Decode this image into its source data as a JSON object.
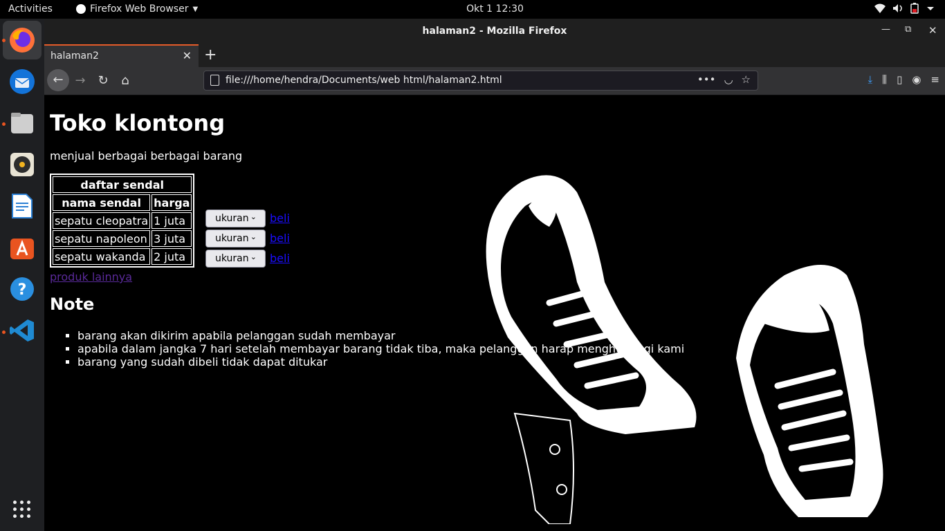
{
  "topbar": {
    "activities": "Activities",
    "app_menu": "Firefox Web Browser",
    "clock": "Okt 1  12:30"
  },
  "dock": {
    "items": [
      "firefox-icon",
      "thunderbird-icon",
      "files-icon",
      "rhythmbox-icon",
      "libreoffice-writer-icon",
      "software-center-icon",
      "help-icon",
      "vscode-icon"
    ],
    "apps_grid": "show-applications-icon"
  },
  "window": {
    "title": "halaman2 - Mozilla Firefox",
    "tab_title": "halaman2",
    "url": "file:///home/hendra/Documents/web html/halaman2.html"
  },
  "page": {
    "heading": "Toko klontong",
    "subtitle": "menjual berbagai berbagai barang",
    "table": {
      "caption": "daftar sendal",
      "headers": [
        "nama sendal",
        "harga"
      ],
      "rows": [
        {
          "name": "sepatu cleopatra",
          "price": "1 juta",
          "select": "ukuran",
          "buy": "beli"
        },
        {
          "name": "sepatu napoleon",
          "price": "3 juta",
          "select": "ukuran",
          "buy": "beli"
        },
        {
          "name": "sepatu wakanda",
          "price": "2 juta",
          "select": "ukuran",
          "buy": "beli"
        }
      ]
    },
    "other_link": "produk lainnya",
    "note_heading": "Note",
    "notes": [
      "barang akan dikirim apabila pelanggan sudah membayar",
      "apabila dalam jangka 7 hari setelah membayar barang tidak tiba, maka pelanggan harap menghubungi kami",
      "barang yang sudah dibeli tidak dapat ditukar"
    ]
  }
}
